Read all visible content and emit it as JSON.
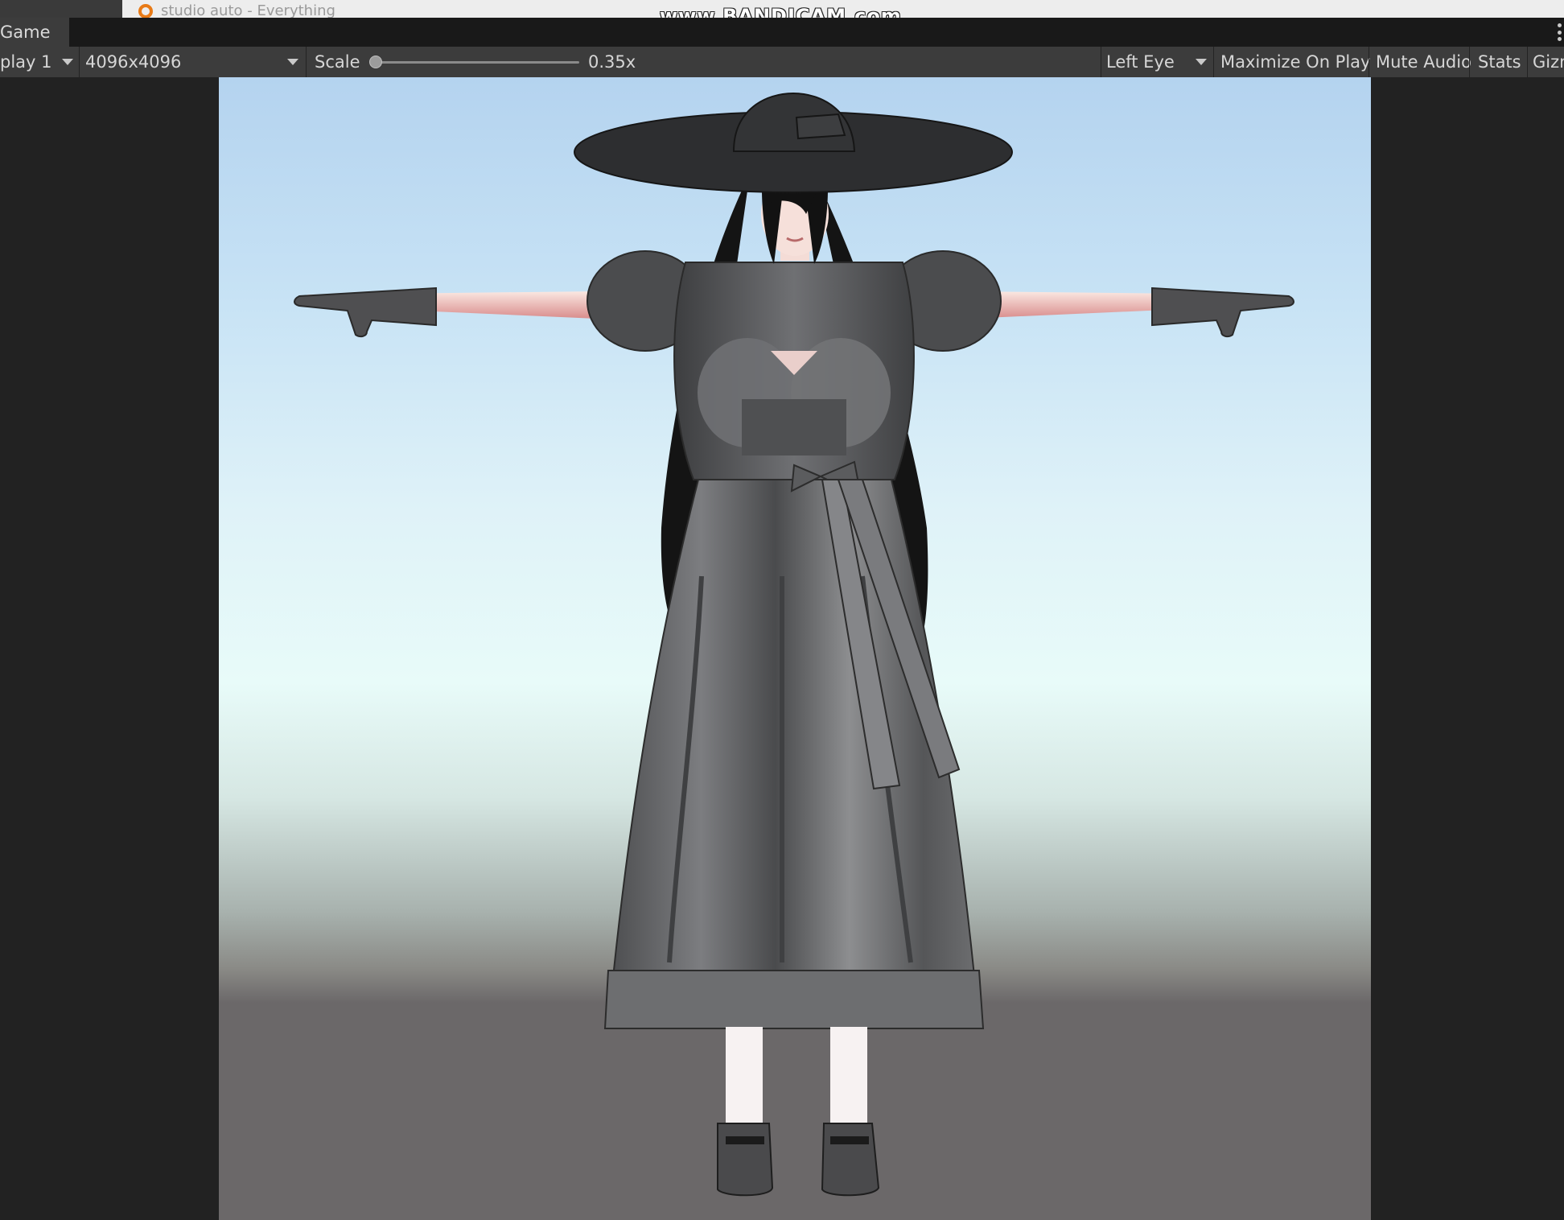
{
  "taskbar": {
    "tab_text": "studio auto - Everything"
  },
  "watermark": "www.BANDICAM.com",
  "window": {
    "tab_label": "Game"
  },
  "toolbar": {
    "display_label": "play 1",
    "resolution_label": "4096x4096",
    "scale_label": "Scale",
    "scale_value": "0.35x",
    "scale_fraction": 0.02,
    "eye_label": "Left Eye",
    "maximize_label": "Maximize On Play",
    "mute_label": "Mute Audio",
    "stats_label": "Stats",
    "gizmos_label": "Gizn"
  },
  "scene": {
    "character": "anime-girl-in-grey-dress-and-wide-black-hat",
    "colors": {
      "sky_top": "#b4d3ef",
      "horizon": "#e8fbf9",
      "ground": "#6b6869",
      "dress": "#5b5c5e",
      "hat": "#2e2f31",
      "hair": "#151515",
      "skin": "#f5ddd8"
    }
  }
}
